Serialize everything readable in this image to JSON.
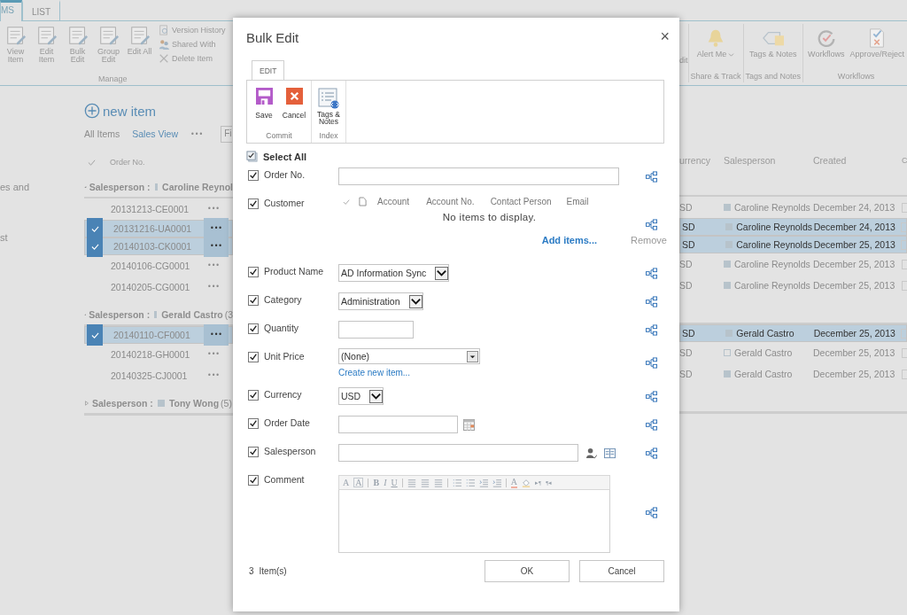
{
  "ribbon": {
    "tabs": [
      {
        "label": "MS",
        "selected": true
      },
      {
        "label": "LIST",
        "selected": false
      }
    ],
    "manage": {
      "label": "Manage",
      "large_buttons": [
        "View Item",
        "Edit Item",
        "Bulk Edit",
        "Group Edit",
        "Edit All"
      ],
      "small_buttons": [
        "Version History",
        "Shared With",
        "Delete Item"
      ]
    },
    "cut_label": "dit",
    "groups": [
      {
        "label": "Share & Track",
        "buttons": [
          {
            "label": "Alert Me",
            "kind": "bell",
            "dropdown": true
          }
        ]
      },
      {
        "label": "Tags and Notes",
        "buttons": [
          {
            "label": "Tags & Notes",
            "kind": "tag",
            "dropdown": false
          }
        ]
      },
      {
        "label": "Workflows",
        "buttons": [
          {
            "label": "Workflows",
            "kind": "workflow",
            "dropdown": false
          },
          {
            "label": "Approve/Reject",
            "kind": "approve",
            "dropdown": false
          }
        ]
      }
    ]
  },
  "left_nav": [
    "es and",
    "st"
  ],
  "list": {
    "new_item": "new item",
    "views": [
      {
        "label": "All Items",
        "selected": false
      },
      {
        "label": "Sales View",
        "selected": true
      }
    ],
    "more": "•••",
    "search_placeholder": "Fi",
    "columns_left": [
      "Order No."
    ],
    "columns_right": [
      "urrency",
      "Salesperson",
      "Created",
      "C"
    ],
    "groups": [
      {
        "label": "Salesperson :",
        "name": "Caroline Reynol",
        "expanded": true,
        "rows": [
          {
            "order_no": "20131213-CE0001",
            "more": "•••",
            "currency": "SD",
            "salesperson": "Caroline Reynolds",
            "presence": true,
            "created": "December 24, 2013",
            "checked": false,
            "selected": false
          },
          {
            "order_no": "20131216-UA0001",
            "more": "•••",
            "currency": "SD",
            "salesperson": "Caroline Reynolds",
            "presence": true,
            "created": "December 24, 2013",
            "checked": false,
            "selected": true
          },
          {
            "order_no": "20140103-CK0001",
            "more": "•••",
            "currency": "SD",
            "salesperson": "Caroline Reynolds",
            "presence": true,
            "created": "December 25, 2013",
            "checked": false,
            "selected": true
          },
          {
            "order_no": "20140106-CG0001",
            "more": "•••",
            "currency": "SD",
            "salesperson": "Caroline Reynolds",
            "presence": true,
            "created": "December 25, 2013",
            "checked": false,
            "selected": false
          },
          {
            "order_no": "20140205-CG0001",
            "more": "•••",
            "currency": "SD",
            "salesperson": "Caroline Reynolds",
            "presence": true,
            "created": "December 25, 2013",
            "checked": false,
            "selected": false
          }
        ]
      },
      {
        "label": "Salesperson :",
        "name": "Gerald Castro",
        "count": "(3",
        "expanded": true,
        "rows": [
          {
            "order_no": "20140110-CF0001",
            "more": "•••",
            "currency": "SD",
            "salesperson": "Gerald Castro",
            "presence": true,
            "created": "December 25, 2013",
            "checked": false,
            "selected": true
          },
          {
            "order_no": "20140218-GH0001",
            "more": "•••",
            "currency": "SD",
            "salesperson": "Gerald Castro",
            "presence": false,
            "created": "December 25, 2013",
            "checked": false,
            "selected": false
          },
          {
            "order_no": "20140325-CJ0001",
            "more": "•••",
            "currency": "SD",
            "salesperson": "Gerald Castro",
            "presence": true,
            "created": "December 25, 2013",
            "checked": false,
            "selected": false
          }
        ]
      },
      {
        "label": "Salesperson :",
        "name": "Tony Wong",
        "count": "(5)",
        "expanded": false
      }
    ]
  },
  "dialog": {
    "title": "Bulk Edit",
    "close": "×",
    "ribbon": {
      "tabs": [
        {
          "label": "EDIT",
          "selected": true
        }
      ],
      "groups": [
        {
          "label": "Commit",
          "buttons": [
            {
              "label": "Save",
              "kind": "save"
            },
            {
              "label": "Cancel",
              "kind": "cancel"
            }
          ]
        },
        {
          "label": "Index",
          "buttons": [
            {
              "label": "Tags & Notes",
              "kind": "tags"
            }
          ]
        }
      ]
    },
    "select_all": "Select All",
    "fields": [
      {
        "label": "Order No.",
        "checked": true,
        "kind": "text"
      },
      {
        "label": "Customer",
        "checked": true,
        "kind": "lookup",
        "columns": [
          "Account",
          "Account No.",
          "Contact Person",
          "Email"
        ],
        "empty_text": "No items to display.",
        "add_link": "Add items...",
        "remove": "Remove",
        "remove_disabled": true
      },
      {
        "label": "Product Name",
        "checked": true,
        "kind": "dropdown",
        "value": "AD Information Sync"
      },
      {
        "label": "Category",
        "checked": true,
        "kind": "dropdown",
        "value": "Administration"
      },
      {
        "label": "Quantity",
        "checked": true,
        "kind": "short_text"
      },
      {
        "label": "Unit Price",
        "checked": true,
        "kind": "lookup_dropdown",
        "value": "(None)",
        "link": "Create new item..."
      },
      {
        "label": "Currency",
        "checked": true,
        "kind": "dropdown",
        "value": "USD"
      },
      {
        "label": "Order Date",
        "checked": true,
        "kind": "date"
      },
      {
        "label": "Salesperson",
        "checked": true,
        "kind": "people"
      },
      {
        "label": "Comment",
        "checked": true,
        "kind": "rich_text",
        "toolbar": [
          {
            "kind": "glyph",
            "text": "A"
          },
          {
            "kind": "glyph",
            "text": "A"
          },
          {
            "kind": "sep"
          },
          {
            "kind": "glyph",
            "text": "B"
          },
          {
            "kind": "glyph",
            "text": "I"
          },
          {
            "kind": "glyph",
            "text": "U"
          },
          {
            "kind": "sep"
          },
          {
            "kind": "align"
          },
          {
            "kind": "align"
          },
          {
            "kind": "align"
          },
          {
            "kind": "sep"
          },
          {
            "kind": "list"
          },
          {
            "kind": "list"
          },
          {
            "kind": "indent"
          },
          {
            "kind": "indent"
          },
          {
            "kind": "sep"
          },
          {
            "kind": "glyph",
            "text": "A"
          },
          {
            "kind": "fill"
          },
          {
            "kind": "glyph",
            "text": "▸¶"
          },
          {
            "kind": "glyph",
            "text": "¶◂"
          }
        ]
      }
    ],
    "footer": {
      "count": "3",
      "count_label": "Item(s)",
      "buttons": [
        "OK",
        "Cancel"
      ]
    }
  }
}
